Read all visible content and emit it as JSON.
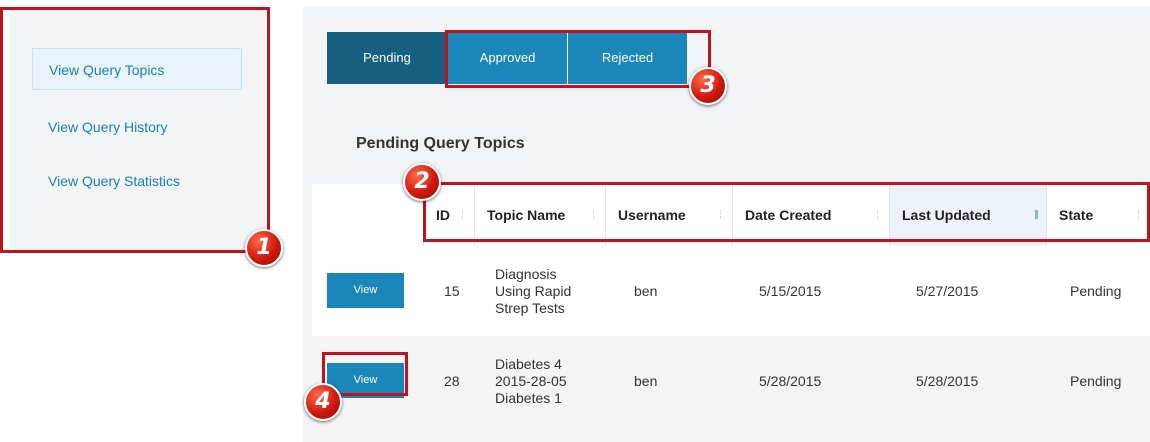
{
  "sidebar": {
    "items": [
      {
        "label": "View Query Topics",
        "active": true
      },
      {
        "label": "View Query History",
        "active": false
      },
      {
        "label": "View Query Statistics",
        "active": false
      }
    ]
  },
  "tabs": [
    {
      "label": "Pending",
      "active": true
    },
    {
      "label": "Approved",
      "active": false
    },
    {
      "label": "Rejected",
      "active": false
    }
  ],
  "section_title": "Pending Query Topics",
  "table": {
    "columns": [
      "",
      "ID",
      "Topic Name",
      "Username",
      "Date Created",
      "Last Updated",
      "State"
    ],
    "sorted_column": "Last Updated",
    "rows": [
      {
        "button": "View",
        "id": "15",
        "topic": [
          "Diagnosis",
          "Using Rapid",
          "Strep Tests"
        ],
        "username": "ben",
        "created": "5/15/2015",
        "updated": "5/27/2015",
        "state": "Pending"
      },
      {
        "button": "View",
        "id": "28",
        "topic": [
          "Diabetes 4",
          "2015-28-05",
          "Diabetes 1"
        ],
        "username": "ben",
        "created": "5/28/2015",
        "updated": "5/28/2015",
        "state": "Pending"
      }
    ]
  },
  "annotations": [
    "1",
    "2",
    "3",
    "4"
  ],
  "colors": {
    "primary": "#1a86b9",
    "primary_dark": "#155f80",
    "link": "#1a7fb5",
    "annotation": "#c1121f"
  }
}
